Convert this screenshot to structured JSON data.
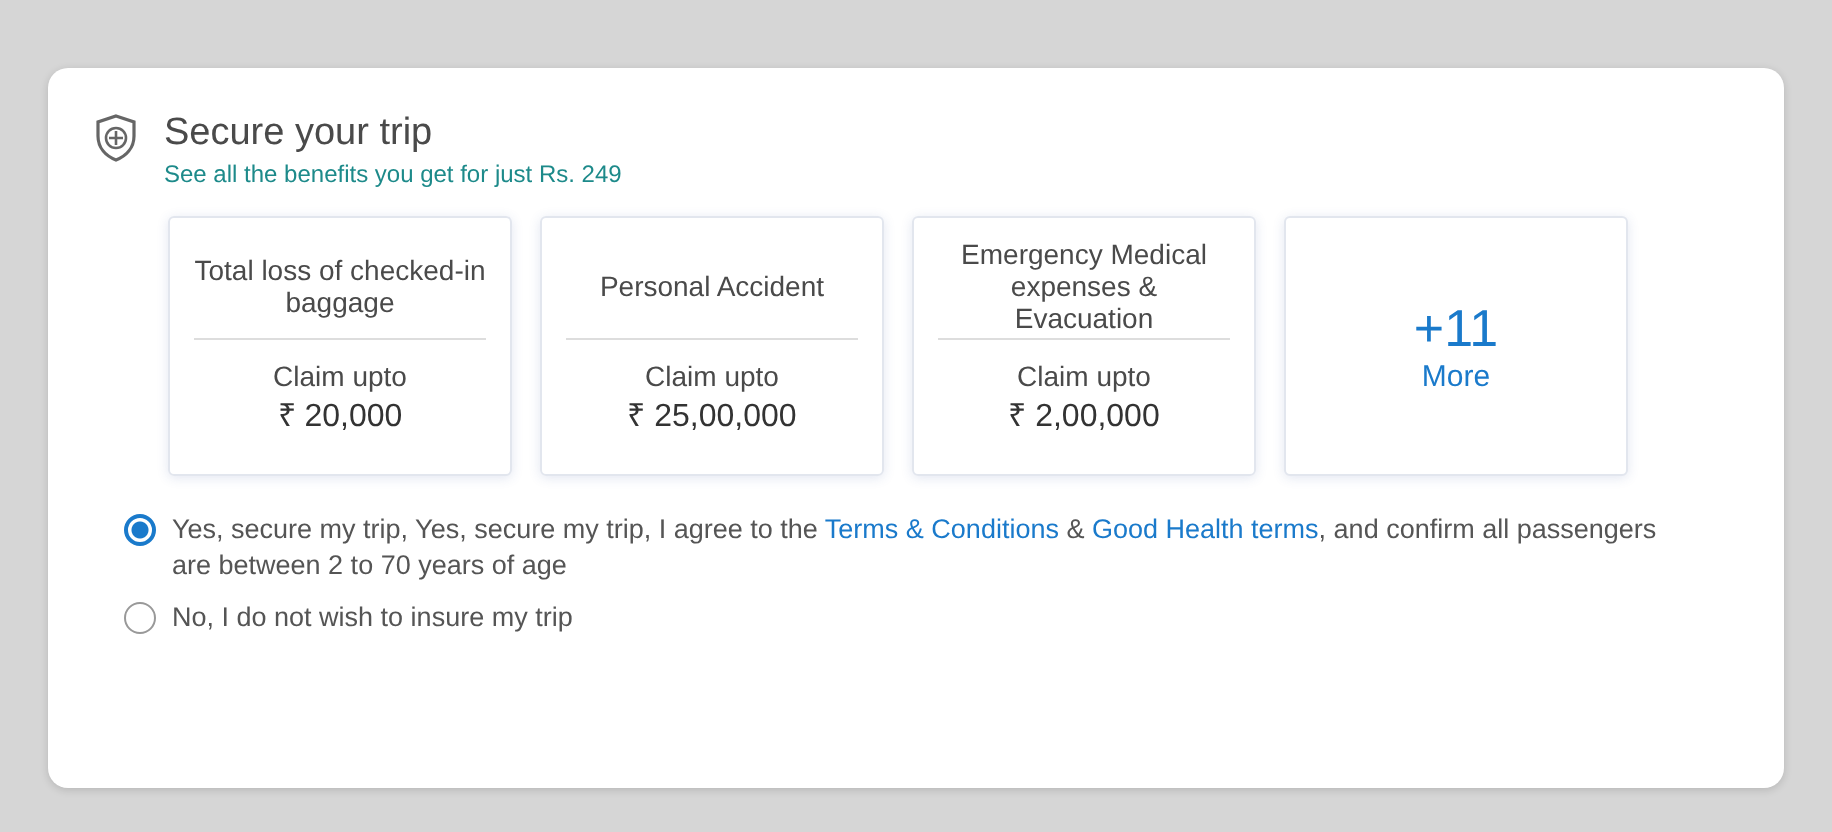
{
  "section": {
    "title": "Secure your trip",
    "subtitle": "See all the benefits you get for just Rs. 249"
  },
  "benefits": [
    {
      "name": "Total loss of checked-in baggage",
      "claim_label": "Claim upto",
      "amount": "₹ 20,000"
    },
    {
      "name": "Personal Accident",
      "claim_label": "Claim upto",
      "amount": "₹ 25,00,000"
    },
    {
      "name": "Emergency Medical expenses & Evacuation",
      "claim_label": "Claim upto",
      "amount": "₹ 2,00,000"
    }
  ],
  "more": {
    "count": "+11",
    "label": "More"
  },
  "options": [
    {
      "selected": true,
      "parts": [
        {
          "kind": "text",
          "text": "Yes, secure my trip, Yes, secure my trip, I agree to the "
        },
        {
          "kind": "link",
          "text": "Terms & Conditions"
        },
        {
          "kind": "text",
          "text": " & "
        },
        {
          "kind": "link",
          "text": "Good Health terms"
        },
        {
          "kind": "text",
          "text": ", and confirm all passengers are between 2 to 70 years of age"
        }
      ]
    },
    {
      "selected": false,
      "parts": [
        {
          "kind": "text",
          "text": "No, I do not wish to insure my trip"
        }
      ]
    }
  ]
}
